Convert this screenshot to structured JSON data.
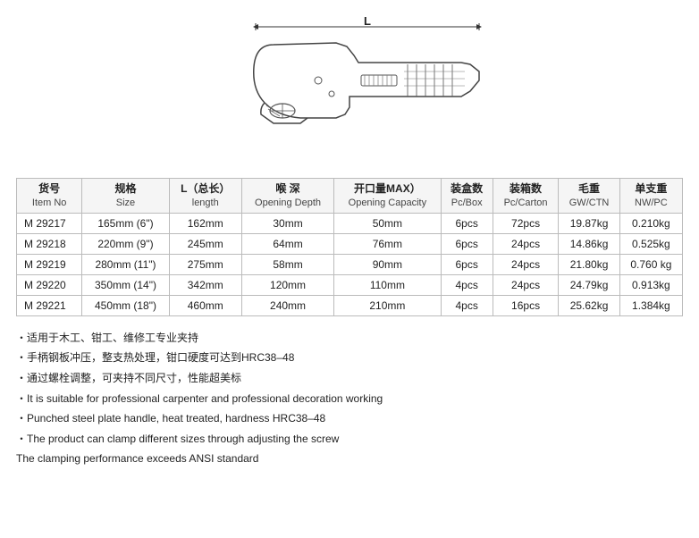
{
  "diagram": {
    "label_L": "L"
  },
  "table": {
    "headers": [
      {
        "main": "货号",
        "sub": "Item No"
      },
      {
        "main": "规格",
        "sub": "Size"
      },
      {
        "main": "L（总长）",
        "sub": "length"
      },
      {
        "main": "喉 深",
        "sub": "Opening Depth"
      },
      {
        "main": "开口量MAX）",
        "sub": "Opening Capacity"
      },
      {
        "main": "装盒数",
        "sub": "Pc/Box"
      },
      {
        "main": "装箱数",
        "sub": "Pc/Carton"
      },
      {
        "main": "毛重",
        "sub": "GW/CTN"
      },
      {
        "main": "单支重",
        "sub": "NW/PC"
      }
    ],
    "rows": [
      [
        "M 29217",
        "165mm (6\")",
        "162mm",
        "30mm",
        "50mm",
        "6pcs",
        "72pcs",
        "19.87kg",
        "0.210kg"
      ],
      [
        "M 29218",
        "220mm (9\")",
        "245mm",
        "64mm",
        "76mm",
        "6pcs",
        "24pcs",
        "14.86kg",
        "0.525kg"
      ],
      [
        "M 29219",
        "280mm (11\")",
        "275mm",
        "58mm",
        "90mm",
        "6pcs",
        "24pcs",
        "21.80kg",
        "0.760 kg"
      ],
      [
        "M 29220",
        "350mm (14\")",
        "342mm",
        "120mm",
        "110mm",
        "4pcs",
        "24pcs",
        "24.79kg",
        "0.913kg"
      ],
      [
        "M 29221",
        "450mm (18\")",
        "460mm",
        "240mm",
        "210mm",
        "4pcs",
        "16pcs",
        "25.62kg",
        "1.384kg"
      ]
    ]
  },
  "features": [
    "・适用于木工、钳工、维修工专业夹持",
    "・手柄钢板冲压，整支热处理，钳口硬度可达到HRC38–48",
    "・通过螺栓调整，可夹持不同尺寸，性能超美标",
    "・It is suitable for professional carpenter and professional decoration working",
    "・Punched steel plate handle, heat treated, hardness HRC38–48",
    "・The product can clamp different sizes through adjusting the screw",
    "The clamping performance exceeds ANSI standard"
  ]
}
